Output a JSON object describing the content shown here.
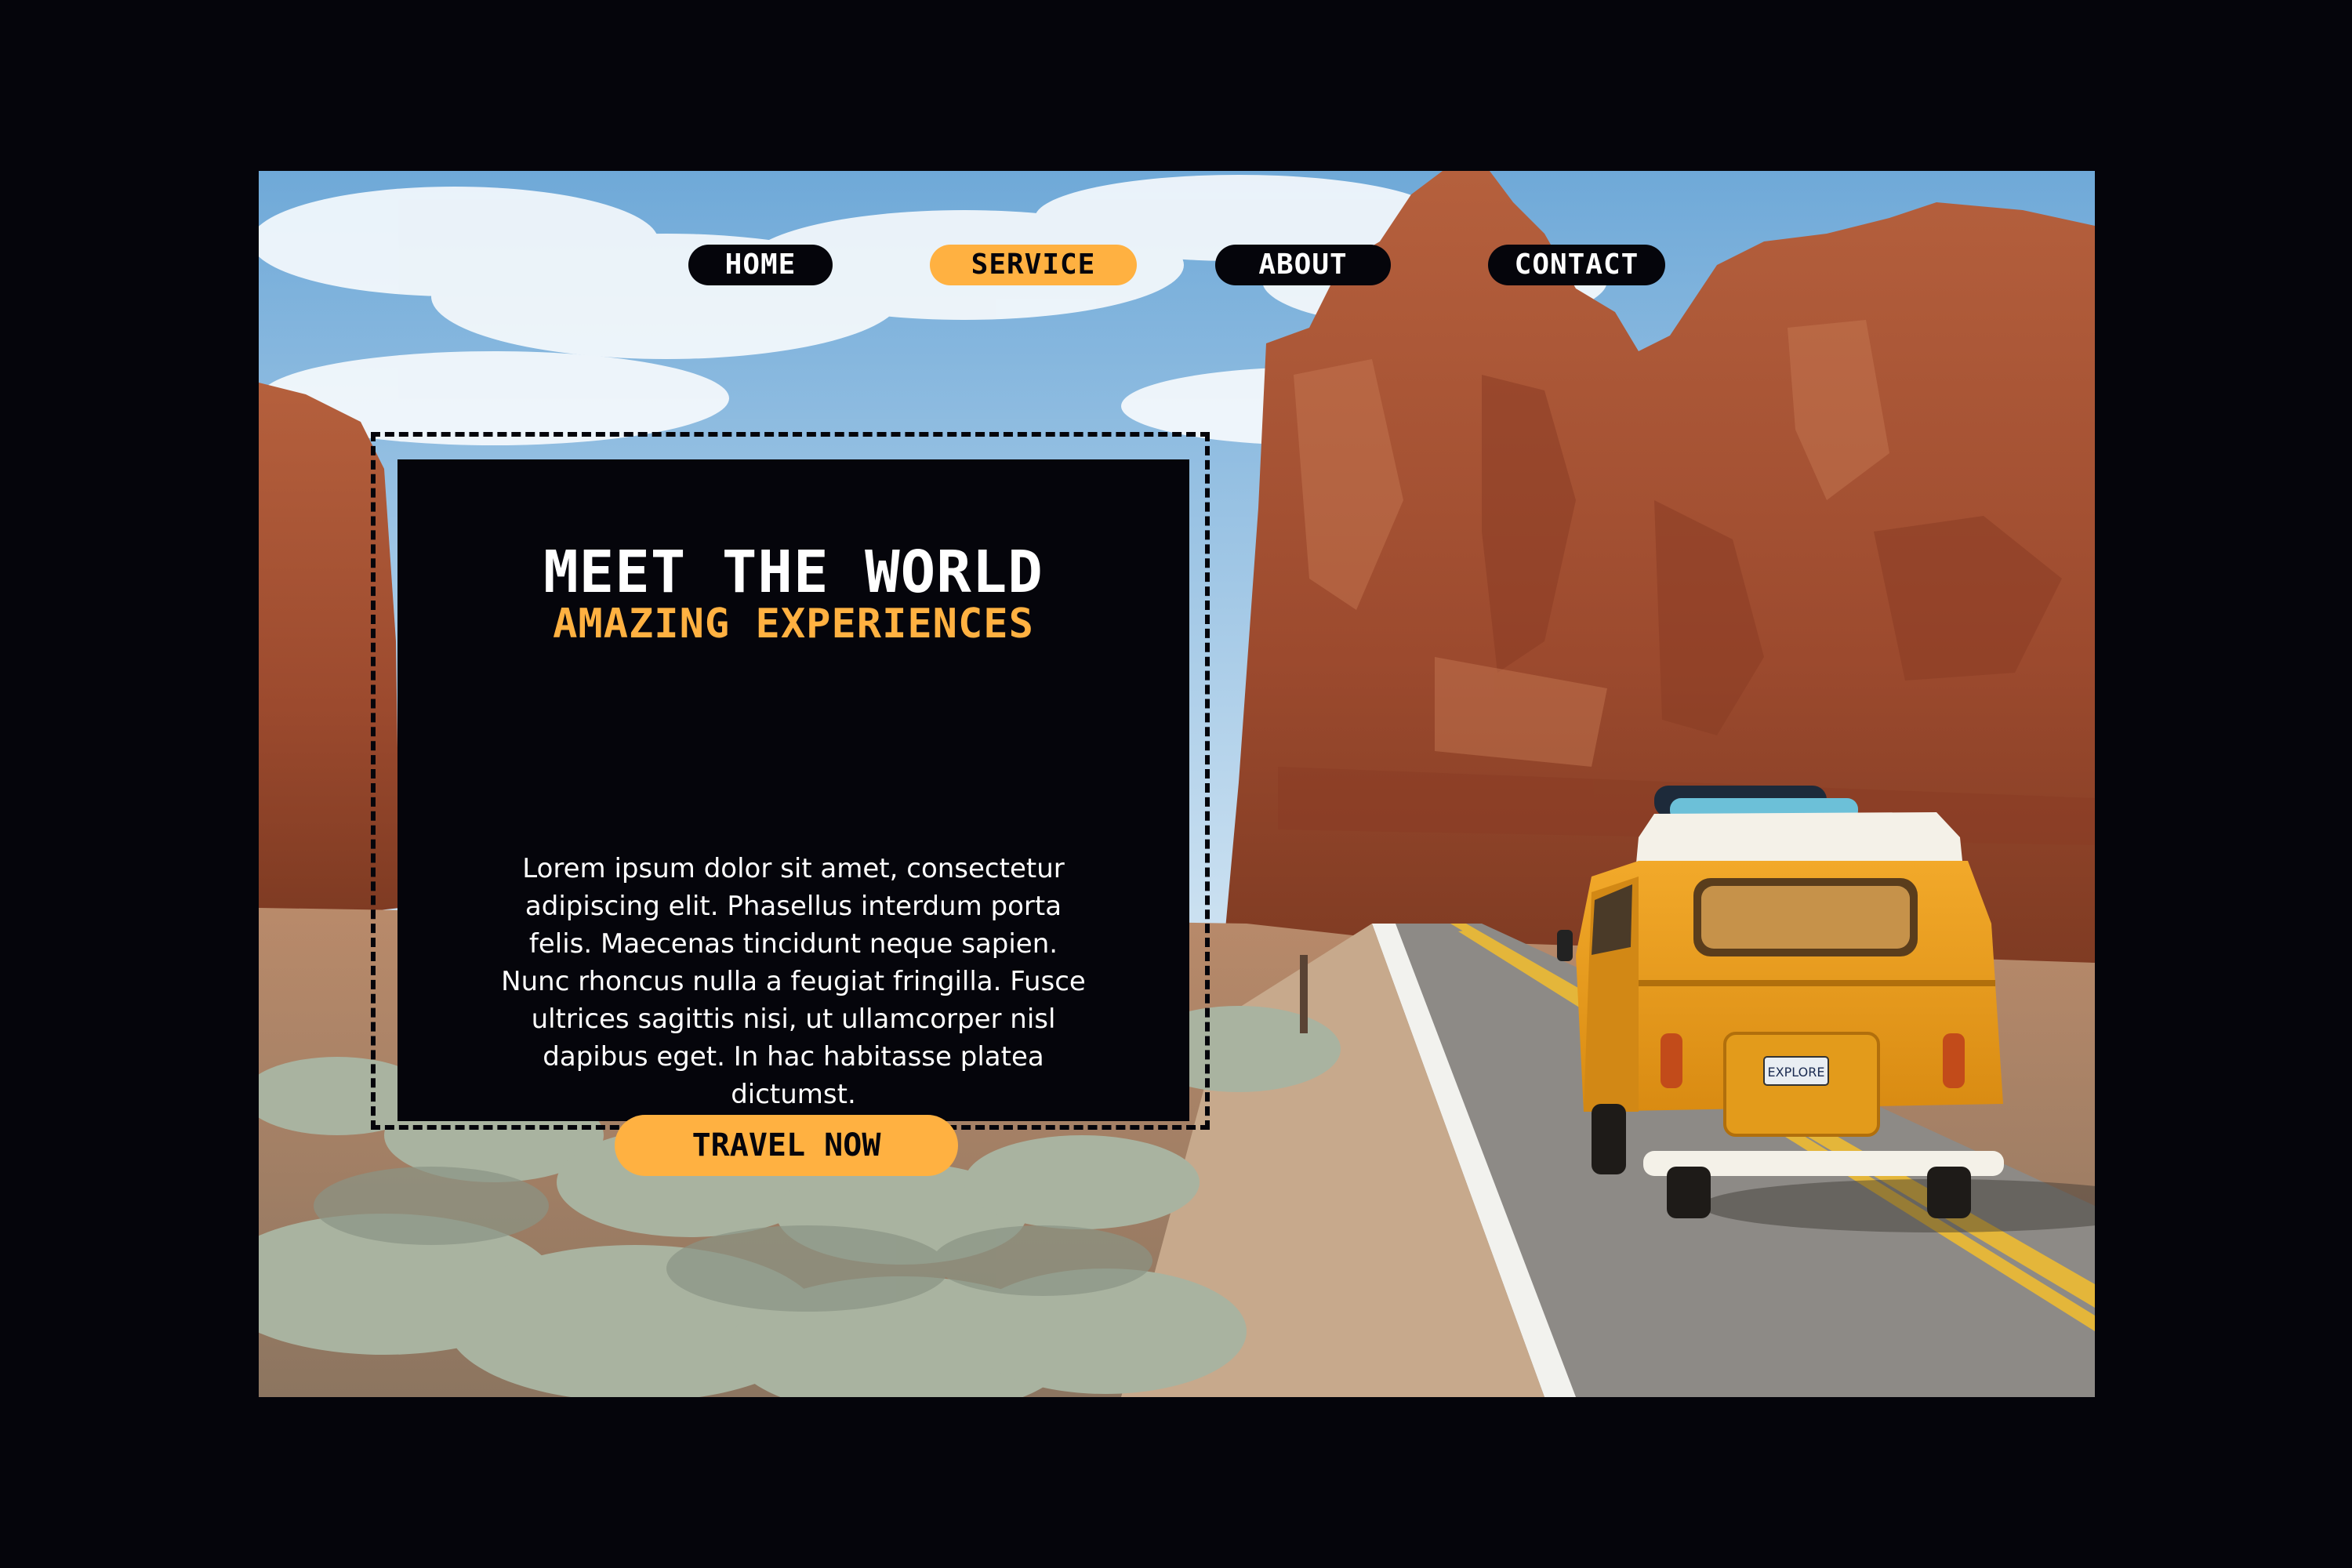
{
  "nav": {
    "items": [
      {
        "label": "HOME"
      },
      {
        "label": "SERVICE",
        "active": true
      },
      {
        "label": "ABOUT"
      },
      {
        "label": "CONTACT"
      }
    ]
  },
  "hero": {
    "title": "MEET THE WORLD",
    "subtitle": "AMAZING EXPERIENCES",
    "body": "Lorem ipsum dolor sit amet, consectetur adipiscing elit. Phasellus interdum porta felis. Maecenas tincidunt neque sapien. Nunc rhoncus nulla a feugiat fringilla. Fusce ultrices sagittis nisi, ut ullamcorper nisl dapibus eget. In hac habitasse platea dictumst.",
    "cta_label": "TRAVEL NOW"
  },
  "van": {
    "plate": "EXPLORE"
  },
  "colors": {
    "background": "#05050b",
    "accent": "#ffb141",
    "text_light": "#ffffff"
  }
}
